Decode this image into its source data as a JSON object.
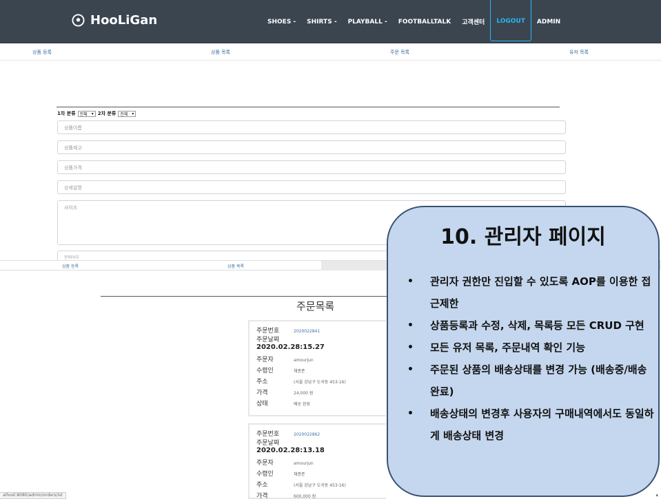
{
  "navbar": {
    "brand": "HooLiGan",
    "menu": [
      "SHOES -",
      "SHIRTS -",
      "PLAYBALL -",
      "FOOTBALLTALK",
      "고객센터",
      "LOGOUT",
      "ADMIN"
    ]
  },
  "admin_nav": {
    "items": [
      "상품 등록",
      "상품 목록",
      "주문 목록",
      "유저 목록"
    ]
  },
  "product_form": {
    "category1_label": "1차 분류",
    "category1_value": "전체",
    "category2_label": "2차 분류",
    "category2_value": "전체",
    "name_placeholder": "상품이름",
    "stock_placeholder": "상품재고",
    "price_placeholder": "상품가격",
    "desc_placeholder": "상세설명",
    "size_placeholder": "사이즈",
    "cut_field": "판매여부"
  },
  "order_nav": {
    "items": [
      "상품 등록",
      "상품 목록"
    ]
  },
  "order_list": {
    "title": "주문목록",
    "orders": [
      {
        "no_label": "주문번호",
        "no": "2020022841",
        "date_label": "주문날짜",
        "date": "2020.02.28:15.27",
        "buyer_label": "주문자",
        "buyer": "amourjun",
        "receiver_label": "수령인",
        "receiver": "채종준",
        "addr_label": "주소",
        "addr": "(서울 강남구 도곡동 453-16)",
        "price_label": "가격",
        "price": "24,000 원",
        "status_label": "상태",
        "status": "배송 완료"
      },
      {
        "no_label": "주문번호",
        "no": "2020022862",
        "date_label": "주문날짜",
        "date": "2020.02.28:13.18",
        "buyer_label": "주문자",
        "buyer": "amourjun",
        "receiver_label": "수령인",
        "receiver": "채종준",
        "addr_label": "주소",
        "addr": "(서울 강남구 도곡동 453-16)",
        "price_label": "가격",
        "price": "600,000 원"
      }
    ]
  },
  "status_bar": "alhost:8080/admin/orders/ist",
  "callout": {
    "title": "10. 관리자 페이지",
    "bullets": [
      "관리자 권한만 진입할 수 있도록 AOP를 이용한 접근제한",
      "상품등록과 수정, 삭제, 목록등 모든 CRUD 구현",
      "모든 유저 목록, 주문내역 확인 기능",
      "주문된 상품의 배송상태를 변경 가능 (배송중/배송완료)",
      "배송상태의 변경후 사용자의 구매내역에서도 동일하게 배송상태 변경"
    ]
  },
  "colors": {
    "navbar_bg": "#3b4550",
    "logout_accent": "#29b6f6",
    "link": "#3b6fa5",
    "callout_bg": "#c5d7ee",
    "callout_border": "#3a5075"
  }
}
